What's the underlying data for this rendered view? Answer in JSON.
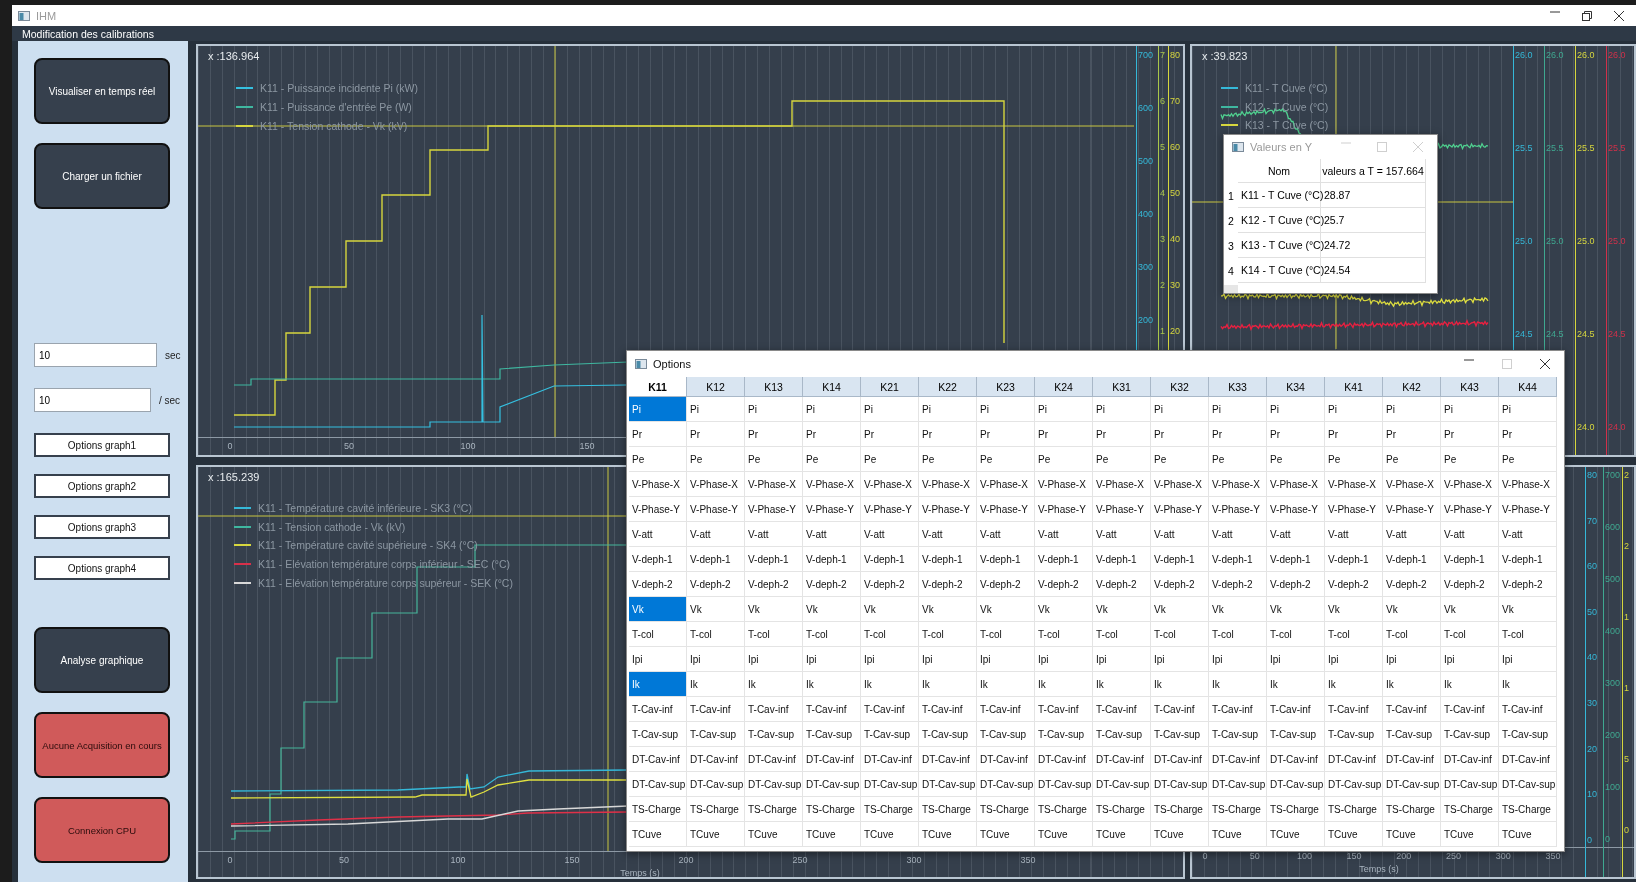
{
  "window": {
    "title": "IHM"
  },
  "menu_bar": {
    "items": [
      {
        "label": "Modification des calibrations"
      }
    ]
  },
  "sidebar": {
    "top_buttons": [
      "Visualiser en temps réel",
      "Charger un fichier"
    ],
    "fields": [
      {
        "value": "10",
        "unit": "sec"
      },
      {
        "value": "10",
        "unit": "/ sec"
      }
    ],
    "option_buttons": [
      "Options graph1",
      "Options graph2",
      "Options graph3",
      "Options graph4"
    ],
    "bottom_buttons": [
      {
        "label": "Analyse graphique",
        "kind": "normal"
      },
      {
        "label": "Aucune Acquisition en cours",
        "kind": "alert"
      },
      {
        "label": "Connexion CPU",
        "kind": "alert"
      }
    ]
  },
  "charts": [
    {
      "readout": "x :136.964",
      "legend": [
        {
          "label": "K11 - Puissance incidente Pi (kW)",
          "color": "#35c0e0"
        },
        {
          "label": "K11 - Puissance d'entrée Pe (W)",
          "color": "#3fb7a0"
        },
        {
          "label": "K11 - Tension cathode - Vk (kV)",
          "color": "#d6d63e"
        }
      ],
      "x_ticks": [
        "0",
        "50",
        "100",
        "150"
      ],
      "y_axes": [
        {
          "color": "#35b8d8",
          "ticks": [
            "700",
            "600",
            "500",
            "400",
            "300",
            "200"
          ]
        },
        {
          "color": "#a9c64a",
          "ticks": [
            "7",
            "6",
            "5",
            "4",
            "3",
            "2",
            "1"
          ]
        },
        {
          "color": "#d6d63e",
          "ticks": [
            "80",
            "70",
            "60",
            "50",
            "40",
            "30",
            "20"
          ]
        }
      ]
    },
    {
      "readout": "x :39.823",
      "legend": [
        {
          "label": "K11 - T Cuve (°C)",
          "color": "#35b8d8"
        },
        {
          "label": "K12 - T Cuve (°C)",
          "color": "#3fb7a0"
        },
        {
          "label": "K13 - T Cuve (°C)",
          "color": "#d6d63e"
        }
      ],
      "y_axes": [
        {
          "color": "#35b8d8",
          "ticks": [
            "26.0",
            "25.5",
            "25.0",
            "24.5"
          ]
        },
        {
          "color": "#3fa890",
          "ticks": [
            "26.0",
            "25.5",
            "25.0",
            "24.5"
          ]
        },
        {
          "color": "#d6d63e",
          "ticks": [
            "26.0",
            "25.5",
            "25.0",
            "24.5",
            "24.0"
          ]
        },
        {
          "color": "#d0304a",
          "ticks": [
            "26.0",
            "25.5",
            "25.0",
            "24.5",
            "24.0"
          ]
        }
      ]
    },
    {
      "readout": "x :165.239",
      "legend": [
        {
          "label": "K11 - Température cavité inférieure - SK3 (°C)",
          "color": "#35b8d8"
        },
        {
          "label": "K11 - Tension cathode - Vk (kV)",
          "color": "#3fb7a0"
        },
        {
          "label": "K11 - Température cavité supérieure - SK4 (°C)",
          "color": "#d6d63e"
        },
        {
          "label": "K11 - Elévation température corps inférieur - SEC (°C)",
          "color": "#d8304a"
        },
        {
          "label": "K11 - Elévation température corps supéreur - SEK (°C)",
          "color": "#d8d8d8"
        }
      ],
      "x_ticks": [
        "0",
        "50",
        "100",
        "150",
        "200",
        "250",
        "300",
        "350"
      ],
      "x_label": "Temps (s)"
    },
    {
      "x_ticks": [
        "0",
        "50",
        "100",
        "150",
        "200",
        "250",
        "300",
        "350"
      ],
      "x_label": "Temps (s)",
      "y_axes": [
        {
          "color": "#35b8d8",
          "ticks": [
            "80",
            "70",
            "60",
            "50",
            "40",
            "30",
            "20",
            "10",
            "0"
          ]
        },
        {
          "color": "#3fa890",
          "ticks": [
            "700",
            "600",
            "500",
            "400",
            "300",
            "200",
            "100",
            "0"
          ]
        },
        {
          "color": "#d6d63e",
          "ticks": [
            "2",
            "2",
            "1",
            "1",
            "5",
            "0"
          ]
        }
      ]
    }
  ],
  "values_window": {
    "title": "Valeurs en Y",
    "columns": [
      "Nom",
      "valeurs a T = 157.664"
    ],
    "rows": [
      {
        "index": "1",
        "name": "K11 - T Cuve (°C)",
        "value": "28.87"
      },
      {
        "index": "2",
        "name": "K12 - T Cuve (°C)",
        "value": "25.7"
      },
      {
        "index": "3",
        "name": "K13 - T Cuve (°C)",
        "value": "24.72"
      },
      {
        "index": "4",
        "name": "K14 - T Cuve (°C)",
        "value": "24.54"
      }
    ]
  },
  "options_window": {
    "title": "Options",
    "columns": [
      {
        "label": "K11",
        "selected": true
      },
      {
        "label": "K12",
        "selected": false
      },
      {
        "label": "K13",
        "selected": false
      },
      {
        "label": "K14",
        "selected": false
      },
      {
        "label": "K21",
        "selected": false
      },
      {
        "label": "K22",
        "selected": false
      },
      {
        "label": "K23",
        "selected": false
      },
      {
        "label": "K24",
        "selected": false
      },
      {
        "label": "K31",
        "selected": false
      },
      {
        "label": "K32",
        "selected": false
      },
      {
        "label": "K33",
        "selected": false
      },
      {
        "label": "K34",
        "selected": false
      },
      {
        "label": "K41",
        "selected": false
      },
      {
        "label": "K42",
        "selected": false
      },
      {
        "label": "K43",
        "selected": false
      },
      {
        "label": "K44",
        "selected": false
      }
    ],
    "rows": [
      {
        "cells": [
          {
            "text": "Pi",
            "selected": true
          },
          {
            "text": "Pi",
            "selected": false
          },
          {
            "text": "Pi",
            "selected": false
          },
          {
            "text": "Pi",
            "selected": false
          },
          {
            "text": "Pi",
            "selected": false
          },
          {
            "text": "Pi",
            "selected": false
          },
          {
            "text": "Pi",
            "selected": false
          },
          {
            "text": "Pi",
            "selected": false
          },
          {
            "text": "Pi",
            "selected": false
          },
          {
            "text": "Pi",
            "selected": false
          },
          {
            "text": "Pi",
            "selected": false
          },
          {
            "text": "Pi",
            "selected": false
          },
          {
            "text": "Pi",
            "selected": false
          },
          {
            "text": "Pi",
            "selected": false
          },
          {
            "text": "Pi",
            "selected": false
          },
          {
            "text": "Pi",
            "selected": false
          }
        ]
      },
      {
        "cells": [
          {
            "text": "Pr",
            "selected": false
          },
          {
            "text": "Pr",
            "selected": false
          },
          {
            "text": "Pr",
            "selected": false
          },
          {
            "text": "Pr",
            "selected": false
          },
          {
            "text": "Pr",
            "selected": false
          },
          {
            "text": "Pr",
            "selected": false
          },
          {
            "text": "Pr",
            "selected": false
          },
          {
            "text": "Pr",
            "selected": false
          },
          {
            "text": "Pr",
            "selected": false
          },
          {
            "text": "Pr",
            "selected": false
          },
          {
            "text": "Pr",
            "selected": false
          },
          {
            "text": "Pr",
            "selected": false
          },
          {
            "text": "Pr",
            "selected": false
          },
          {
            "text": "Pr",
            "selected": false
          },
          {
            "text": "Pr",
            "selected": false
          },
          {
            "text": "Pr",
            "selected": false
          }
        ]
      },
      {
        "cells": [
          {
            "text": "Pe",
            "selected": false
          },
          {
            "text": "Pe",
            "selected": false
          },
          {
            "text": "Pe",
            "selected": false
          },
          {
            "text": "Pe",
            "selected": false
          },
          {
            "text": "Pe",
            "selected": false
          },
          {
            "text": "Pe",
            "selected": false
          },
          {
            "text": "Pe",
            "selected": false
          },
          {
            "text": "Pe",
            "selected": false
          },
          {
            "text": "Pe",
            "selected": false
          },
          {
            "text": "Pe",
            "selected": false
          },
          {
            "text": "Pe",
            "selected": false
          },
          {
            "text": "Pe",
            "selected": false
          },
          {
            "text": "Pe",
            "selected": false
          },
          {
            "text": "Pe",
            "selected": false
          },
          {
            "text": "Pe",
            "selected": false
          },
          {
            "text": "Pe",
            "selected": false
          }
        ]
      },
      {
        "cells": [
          {
            "text": "V-Phase-X",
            "selected": false
          },
          {
            "text": "V-Phase-X",
            "selected": false
          },
          {
            "text": "V-Phase-X",
            "selected": false
          },
          {
            "text": "V-Phase-X",
            "selected": false
          },
          {
            "text": "V-Phase-X",
            "selected": false
          },
          {
            "text": "V-Phase-X",
            "selected": false
          },
          {
            "text": "V-Phase-X",
            "selected": false
          },
          {
            "text": "V-Phase-X",
            "selected": false
          },
          {
            "text": "V-Phase-X",
            "selected": false
          },
          {
            "text": "V-Phase-X",
            "selected": false
          },
          {
            "text": "V-Phase-X",
            "selected": false
          },
          {
            "text": "V-Phase-X",
            "selected": false
          },
          {
            "text": "V-Phase-X",
            "selected": false
          },
          {
            "text": "V-Phase-X",
            "selected": false
          },
          {
            "text": "V-Phase-X",
            "selected": false
          },
          {
            "text": "V-Phase-X",
            "selected": false
          }
        ]
      },
      {
        "cells": [
          {
            "text": "V-Phase-Y",
            "selected": false
          },
          {
            "text": "V-Phase-Y",
            "selected": false
          },
          {
            "text": "V-Phase-Y",
            "selected": false
          },
          {
            "text": "V-Phase-Y",
            "selected": false
          },
          {
            "text": "V-Phase-Y",
            "selected": false
          },
          {
            "text": "V-Phase-Y",
            "selected": false
          },
          {
            "text": "V-Phase-Y",
            "selected": false
          },
          {
            "text": "V-Phase-Y",
            "selected": false
          },
          {
            "text": "V-Phase-Y",
            "selected": false
          },
          {
            "text": "V-Phase-Y",
            "selected": false
          },
          {
            "text": "V-Phase-Y",
            "selected": false
          },
          {
            "text": "V-Phase-Y",
            "selected": false
          },
          {
            "text": "V-Phase-Y",
            "selected": false
          },
          {
            "text": "V-Phase-Y",
            "selected": false
          },
          {
            "text": "V-Phase-Y",
            "selected": false
          },
          {
            "text": "V-Phase-Y",
            "selected": false
          }
        ]
      },
      {
        "cells": [
          {
            "text": "V-att",
            "selected": false
          },
          {
            "text": "V-att",
            "selected": false
          },
          {
            "text": "V-att",
            "selected": false
          },
          {
            "text": "V-att",
            "selected": false
          },
          {
            "text": "V-att",
            "selected": false
          },
          {
            "text": "V-att",
            "selected": false
          },
          {
            "text": "V-att",
            "selected": false
          },
          {
            "text": "V-att",
            "selected": false
          },
          {
            "text": "V-att",
            "selected": false
          },
          {
            "text": "V-att",
            "selected": false
          },
          {
            "text": "V-att",
            "selected": false
          },
          {
            "text": "V-att",
            "selected": false
          },
          {
            "text": "V-att",
            "selected": false
          },
          {
            "text": "V-att",
            "selected": false
          },
          {
            "text": "V-att",
            "selected": false
          },
          {
            "text": "V-att",
            "selected": false
          }
        ]
      },
      {
        "cells": [
          {
            "text": "V-deph-1",
            "selected": false
          },
          {
            "text": "V-deph-1",
            "selected": false
          },
          {
            "text": "V-deph-1",
            "selected": false
          },
          {
            "text": "V-deph-1",
            "selected": false
          },
          {
            "text": "V-deph-1",
            "selected": false
          },
          {
            "text": "V-deph-1",
            "selected": false
          },
          {
            "text": "V-deph-1",
            "selected": false
          },
          {
            "text": "V-deph-1",
            "selected": false
          },
          {
            "text": "V-deph-1",
            "selected": false
          },
          {
            "text": "V-deph-1",
            "selected": false
          },
          {
            "text": "V-deph-1",
            "selected": false
          },
          {
            "text": "V-deph-1",
            "selected": false
          },
          {
            "text": "V-deph-1",
            "selected": false
          },
          {
            "text": "V-deph-1",
            "selected": false
          },
          {
            "text": "V-deph-1",
            "selected": false
          },
          {
            "text": "V-deph-1",
            "selected": false
          }
        ]
      },
      {
        "cells": [
          {
            "text": "V-deph-2",
            "selected": false
          },
          {
            "text": "V-deph-2",
            "selected": false
          },
          {
            "text": "V-deph-2",
            "selected": false
          },
          {
            "text": "V-deph-2",
            "selected": false
          },
          {
            "text": "V-deph-2",
            "selected": false
          },
          {
            "text": "V-deph-2",
            "selected": false
          },
          {
            "text": "V-deph-2",
            "selected": false
          },
          {
            "text": "V-deph-2",
            "selected": false
          },
          {
            "text": "V-deph-2",
            "selected": false
          },
          {
            "text": "V-deph-2",
            "selected": false
          },
          {
            "text": "V-deph-2",
            "selected": false
          },
          {
            "text": "V-deph-2",
            "selected": false
          },
          {
            "text": "V-deph-2",
            "selected": false
          },
          {
            "text": "V-deph-2",
            "selected": false
          },
          {
            "text": "V-deph-2",
            "selected": false
          },
          {
            "text": "V-deph-2",
            "selected": false
          }
        ]
      },
      {
        "cells": [
          {
            "text": "Vk",
            "selected": true
          },
          {
            "text": "Vk",
            "selected": false
          },
          {
            "text": "Vk",
            "selected": false
          },
          {
            "text": "Vk",
            "selected": false
          },
          {
            "text": "Vk",
            "selected": false
          },
          {
            "text": "Vk",
            "selected": false
          },
          {
            "text": "Vk",
            "selected": false
          },
          {
            "text": "Vk",
            "selected": false
          },
          {
            "text": "Vk",
            "selected": false
          },
          {
            "text": "Vk",
            "selected": false
          },
          {
            "text": "Vk",
            "selected": false
          },
          {
            "text": "Vk",
            "selected": false
          },
          {
            "text": "Vk",
            "selected": false
          },
          {
            "text": "Vk",
            "selected": false
          },
          {
            "text": "Vk",
            "selected": false
          },
          {
            "text": "Vk",
            "selected": false
          }
        ]
      },
      {
        "cells": [
          {
            "text": "T-col",
            "selected": false
          },
          {
            "text": "T-col",
            "selected": false
          },
          {
            "text": "T-col",
            "selected": false
          },
          {
            "text": "T-col",
            "selected": false
          },
          {
            "text": "T-col",
            "selected": false
          },
          {
            "text": "T-col",
            "selected": false
          },
          {
            "text": "T-col",
            "selected": false
          },
          {
            "text": "T-col",
            "selected": false
          },
          {
            "text": "T-col",
            "selected": false
          },
          {
            "text": "T-col",
            "selected": false
          },
          {
            "text": "T-col",
            "selected": false
          },
          {
            "text": "T-col",
            "selected": false
          },
          {
            "text": "T-col",
            "selected": false
          },
          {
            "text": "T-col",
            "selected": false
          },
          {
            "text": "T-col",
            "selected": false
          },
          {
            "text": "T-col",
            "selected": false
          }
        ]
      },
      {
        "cells": [
          {
            "text": "Ipi",
            "selected": false
          },
          {
            "text": "Ipi",
            "selected": false
          },
          {
            "text": "Ipi",
            "selected": false
          },
          {
            "text": "Ipi",
            "selected": false
          },
          {
            "text": "Ipi",
            "selected": false
          },
          {
            "text": "Ipi",
            "selected": false
          },
          {
            "text": "Ipi",
            "selected": false
          },
          {
            "text": "Ipi",
            "selected": false
          },
          {
            "text": "Ipi",
            "selected": false
          },
          {
            "text": "Ipi",
            "selected": false
          },
          {
            "text": "Ipi",
            "selected": false
          },
          {
            "text": "Ipi",
            "selected": false
          },
          {
            "text": "Ipi",
            "selected": false
          },
          {
            "text": "Ipi",
            "selected": false
          },
          {
            "text": "Ipi",
            "selected": false
          },
          {
            "text": "Ipi",
            "selected": false
          }
        ]
      },
      {
        "cells": [
          {
            "text": "Ik",
            "selected": true
          },
          {
            "text": "Ik",
            "selected": false
          },
          {
            "text": "Ik",
            "selected": false
          },
          {
            "text": "Ik",
            "selected": false
          },
          {
            "text": "Ik",
            "selected": false
          },
          {
            "text": "Ik",
            "selected": false
          },
          {
            "text": "Ik",
            "selected": false
          },
          {
            "text": "Ik",
            "selected": false
          },
          {
            "text": "Ik",
            "selected": false
          },
          {
            "text": "Ik",
            "selected": false
          },
          {
            "text": "Ik",
            "selected": false
          },
          {
            "text": "Ik",
            "selected": false
          },
          {
            "text": "Ik",
            "selected": false
          },
          {
            "text": "Ik",
            "selected": false
          },
          {
            "text": "Ik",
            "selected": false
          },
          {
            "text": "Ik",
            "selected": false
          }
        ]
      },
      {
        "cells": [
          {
            "text": "T-Cav-inf",
            "selected": false
          },
          {
            "text": "T-Cav-inf",
            "selected": false
          },
          {
            "text": "T-Cav-inf",
            "selected": false
          },
          {
            "text": "T-Cav-inf",
            "selected": false
          },
          {
            "text": "T-Cav-inf",
            "selected": false
          },
          {
            "text": "T-Cav-inf",
            "selected": false
          },
          {
            "text": "T-Cav-inf",
            "selected": false
          },
          {
            "text": "T-Cav-inf",
            "selected": false
          },
          {
            "text": "T-Cav-inf",
            "selected": false
          },
          {
            "text": "T-Cav-inf",
            "selected": false
          },
          {
            "text": "T-Cav-inf",
            "selected": false
          },
          {
            "text": "T-Cav-inf",
            "selected": false
          },
          {
            "text": "T-Cav-inf",
            "selected": false
          },
          {
            "text": "T-Cav-inf",
            "selected": false
          },
          {
            "text": "T-Cav-inf",
            "selected": false
          },
          {
            "text": "T-Cav-inf",
            "selected": false
          }
        ]
      },
      {
        "cells": [
          {
            "text": "T-Cav-sup",
            "selected": false
          },
          {
            "text": "T-Cav-sup",
            "selected": false
          },
          {
            "text": "T-Cav-sup",
            "selected": false
          },
          {
            "text": "T-Cav-sup",
            "selected": false
          },
          {
            "text": "T-Cav-sup",
            "selected": false
          },
          {
            "text": "T-Cav-sup",
            "selected": false
          },
          {
            "text": "T-Cav-sup",
            "selected": false
          },
          {
            "text": "T-Cav-sup",
            "selected": false
          },
          {
            "text": "T-Cav-sup",
            "selected": false
          },
          {
            "text": "T-Cav-sup",
            "selected": false
          },
          {
            "text": "T-Cav-sup",
            "selected": false
          },
          {
            "text": "T-Cav-sup",
            "selected": false
          },
          {
            "text": "T-Cav-sup",
            "selected": false
          },
          {
            "text": "T-Cav-sup",
            "selected": false
          },
          {
            "text": "T-Cav-sup",
            "selected": false
          },
          {
            "text": "T-Cav-sup",
            "selected": false
          }
        ]
      },
      {
        "cells": [
          {
            "text": "DT-Cav-inf",
            "selected": false
          },
          {
            "text": "DT-Cav-inf",
            "selected": false
          },
          {
            "text": "DT-Cav-inf",
            "selected": false
          },
          {
            "text": "DT-Cav-inf",
            "selected": false
          },
          {
            "text": "DT-Cav-inf",
            "selected": false
          },
          {
            "text": "DT-Cav-inf",
            "selected": false
          },
          {
            "text": "DT-Cav-inf",
            "selected": false
          },
          {
            "text": "DT-Cav-inf",
            "selected": false
          },
          {
            "text": "DT-Cav-inf",
            "selected": false
          },
          {
            "text": "DT-Cav-inf",
            "selected": false
          },
          {
            "text": "DT-Cav-inf",
            "selected": false
          },
          {
            "text": "DT-Cav-inf",
            "selected": false
          },
          {
            "text": "DT-Cav-inf",
            "selected": false
          },
          {
            "text": "DT-Cav-inf",
            "selected": false
          },
          {
            "text": "DT-Cav-inf",
            "selected": false
          },
          {
            "text": "DT-Cav-inf",
            "selected": false
          }
        ]
      },
      {
        "cells": [
          {
            "text": "DT-Cav-sup",
            "selected": false
          },
          {
            "text": "DT-Cav-sup",
            "selected": false
          },
          {
            "text": "DT-Cav-sup",
            "selected": false
          },
          {
            "text": "DT-Cav-sup",
            "selected": false
          },
          {
            "text": "DT-Cav-sup",
            "selected": false
          },
          {
            "text": "DT-Cav-sup",
            "selected": false
          },
          {
            "text": "DT-Cav-sup",
            "selected": false
          },
          {
            "text": "DT-Cav-sup",
            "selected": false
          },
          {
            "text": "DT-Cav-sup",
            "selected": false
          },
          {
            "text": "DT-Cav-sup",
            "selected": false
          },
          {
            "text": "DT-Cav-sup",
            "selected": false
          },
          {
            "text": "DT-Cav-sup",
            "selected": false
          },
          {
            "text": "DT-Cav-sup",
            "selected": false
          },
          {
            "text": "DT-Cav-sup",
            "selected": false
          },
          {
            "text": "DT-Cav-sup",
            "selected": false
          },
          {
            "text": "DT-Cav-sup",
            "selected": false
          }
        ]
      },
      {
        "cells": [
          {
            "text": "TS-Charge",
            "selected": false
          },
          {
            "text": "TS-Charge",
            "selected": false
          },
          {
            "text": "TS-Charge",
            "selected": false
          },
          {
            "text": "TS-Charge",
            "selected": false
          },
          {
            "text": "TS-Charge",
            "selected": false
          },
          {
            "text": "TS-Charge",
            "selected": false
          },
          {
            "text": "TS-Charge",
            "selected": false
          },
          {
            "text": "TS-Charge",
            "selected": false
          },
          {
            "text": "TS-Charge",
            "selected": false
          },
          {
            "text": "TS-Charge",
            "selected": false
          },
          {
            "text": "TS-Charge",
            "selected": false
          },
          {
            "text": "TS-Charge",
            "selected": false
          },
          {
            "text": "TS-Charge",
            "selected": false
          },
          {
            "text": "TS-Charge",
            "selected": false
          },
          {
            "text": "TS-Charge",
            "selected": false
          },
          {
            "text": "TS-Charge",
            "selected": false
          }
        ]
      },
      {
        "cells": [
          {
            "text": "TCuve",
            "selected": false
          },
          {
            "text": "TCuve",
            "selected": false
          },
          {
            "text": "TCuve",
            "selected": false
          },
          {
            "text": "TCuve",
            "selected": false
          },
          {
            "text": "TCuve",
            "selected": false
          },
          {
            "text": "TCuve",
            "selected": false
          },
          {
            "text": "TCuve",
            "selected": false
          },
          {
            "text": "TCuve",
            "selected": false
          },
          {
            "text": "TCuve",
            "selected": false
          },
          {
            "text": "TCuve",
            "selected": false
          },
          {
            "text": "TCuve",
            "selected": false
          },
          {
            "text": "TCuve",
            "selected": false
          },
          {
            "text": "TCuve",
            "selected": false
          },
          {
            "text": "TCuve",
            "selected": false
          },
          {
            "text": "TCuve",
            "selected": false
          },
          {
            "text": "TCuve",
            "selected": false
          }
        ]
      }
    ]
  }
}
